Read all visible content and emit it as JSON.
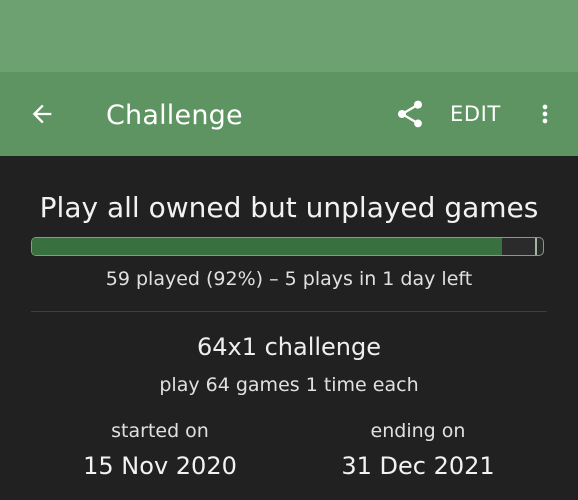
{
  "app_bar": {
    "title": "Challenge",
    "edit_label": "EDIT",
    "icons": {
      "back": "arrow-left-icon",
      "share": "share-icon",
      "more": "more-vert-icon"
    }
  },
  "challenge": {
    "name": "Play all owned but unplayed games",
    "progress": {
      "fraction": 0.92,
      "text": "59 played (92%) – 5 plays in 1 day left"
    },
    "type": "64x1 challenge",
    "description": "play 64 games 1 time each",
    "start": {
      "label": "started on",
      "date": "15 Nov 2020"
    },
    "end": {
      "label": "ending on",
      "date": "31 Dec 2021"
    }
  },
  "colors": {
    "status_bar": "#6ea172",
    "app_bar": "#5d9462",
    "background": "#212121",
    "progress_fill": "#38703f"
  }
}
